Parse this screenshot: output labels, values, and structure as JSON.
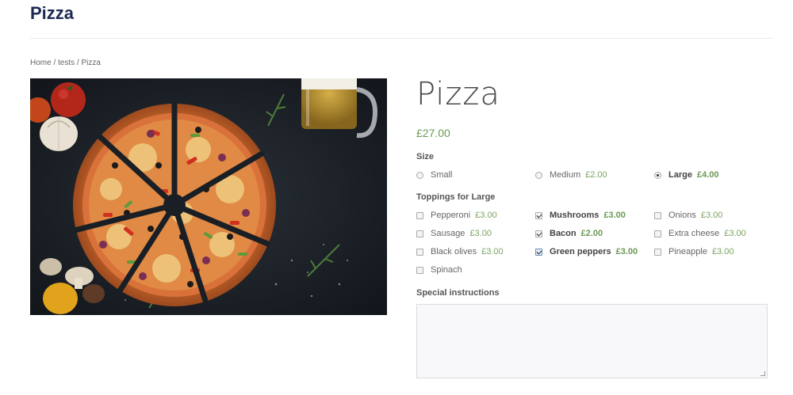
{
  "site": {
    "title": "Pizza"
  },
  "breadcrumb": {
    "home": "Home",
    "sep1": " / ",
    "category": "tests",
    "sep2": " / ",
    "current": "Pizza"
  },
  "product": {
    "title": "Pizza",
    "price": "£27.00"
  },
  "size": {
    "label": "Size",
    "options": [
      {
        "name": "Small",
        "price": "",
        "checked": false
      },
      {
        "name": "Medium",
        "price": "£2.00",
        "checked": false
      },
      {
        "name": "Large",
        "price": "£4.00",
        "checked": true
      }
    ]
  },
  "toppings": {
    "label": "Toppings for Large",
    "options": [
      {
        "name": "Pepperoni",
        "price": "£3.00",
        "checked": false
      },
      {
        "name": "Mushrooms",
        "price": "£3.00",
        "checked": true
      },
      {
        "name": "Onions",
        "price": "£3.00",
        "checked": false
      },
      {
        "name": "Sausage",
        "price": "£3.00",
        "checked": false
      },
      {
        "name": "Bacon",
        "price": "£2.00",
        "checked": true
      },
      {
        "name": "Extra cheese",
        "price": "£3.00",
        "checked": false
      },
      {
        "name": "Black olives",
        "price": "£3.00",
        "checked": false
      },
      {
        "name": "Green peppers",
        "price": "£3.00",
        "checked": true
      },
      {
        "name": "Pineapple",
        "price": "£3.00",
        "checked": false
      },
      {
        "name": "Spinach",
        "price": "",
        "checked": false
      }
    ]
  },
  "special": {
    "label": "Special instructions",
    "value": ""
  },
  "colors": {
    "brand": "#1c2a52",
    "price": "#6a9a54"
  },
  "image": {
    "description_icon": "pizza-photo"
  }
}
